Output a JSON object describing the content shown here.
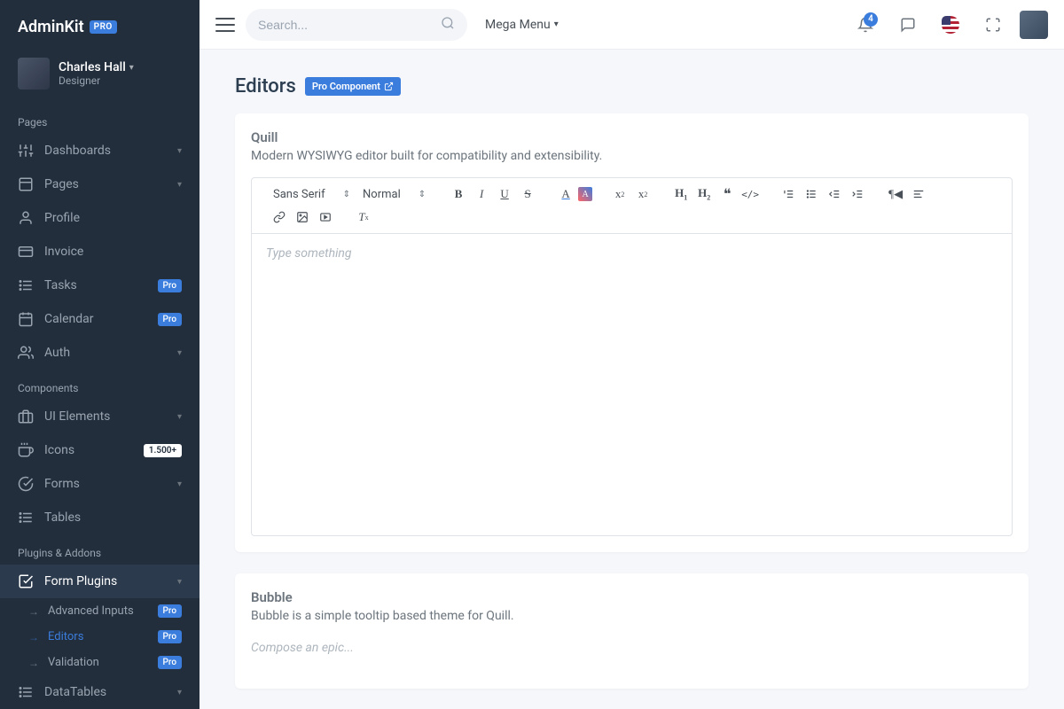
{
  "brand": {
    "name": "AdminKit",
    "badge": "PRO"
  },
  "user": {
    "name": "Charles Hall",
    "role": "Designer"
  },
  "sidebar": {
    "section_pages": "Pages",
    "section_components": "Components",
    "section_plugins": "Plugins & Addons",
    "items": {
      "dashboards": "Dashboards",
      "pages": "Pages",
      "profile": "Profile",
      "invoice": "Invoice",
      "tasks": "Tasks",
      "calendar": "Calendar",
      "auth": "Auth",
      "ui_elements": "UI Elements",
      "icons": "Icons",
      "icons_count": "1.500+",
      "forms": "Forms",
      "tables": "Tables",
      "form_plugins": "Form Plugins",
      "advanced_inputs": "Advanced Inputs",
      "editors": "Editors",
      "validation": "Validation",
      "datatables": "DataTables"
    },
    "pro_badge": "Pro"
  },
  "topbar": {
    "search_placeholder": "Search...",
    "mega_menu": "Mega Menu",
    "notif_count": "4"
  },
  "page": {
    "title": "Editors",
    "pro_component": "Pro Component"
  },
  "quill": {
    "title": "Quill",
    "subtitle": "Modern WYSIWYG editor built for compatibility and extensibility.",
    "font_select": "Sans Serif",
    "heading_select": "Normal",
    "placeholder": "Type something"
  },
  "bubble": {
    "title": "Bubble",
    "subtitle": "Bubble is a simple tooltip based theme for Quill.",
    "placeholder": "Compose an epic..."
  }
}
